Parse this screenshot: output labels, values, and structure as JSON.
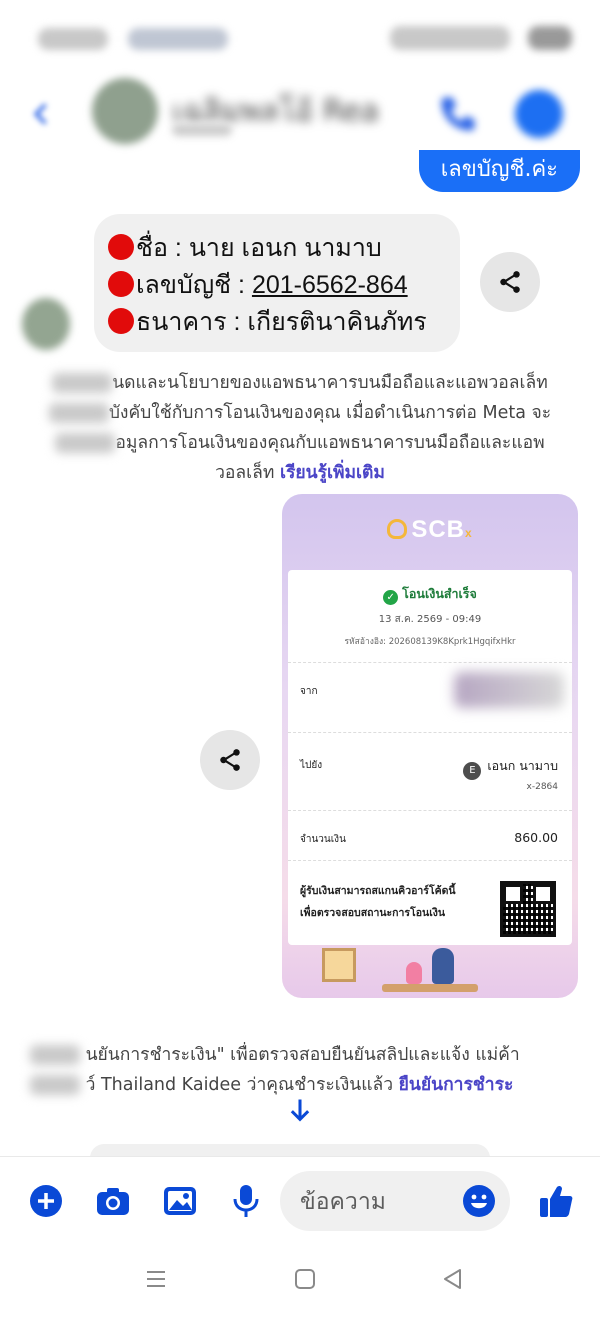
{
  "header": {
    "contact_name": "เฉลิมพลโอ้ Rea",
    "back_icon": "back-arrow-icon",
    "call_icon": "phone-icon",
    "info_icon": "info-icon"
  },
  "messages": {
    "outgoing_partial": "เลขบัญชี.ค่ะ",
    "account_lines": [
      {
        "label": "ชื่อ : นาย เอนก นามาบ",
        "plain": true
      },
      {
        "prefix": "เลขบัญชี : ",
        "value": "201-6562-864"
      },
      {
        "label": "ธนาคาร  : เกียรตินาคินภัทร",
        "plain": true
      }
    ],
    "notice_line1": "นดและนโยบายของแอพธนาคารบนมือถือและแอพวอลเล็ท",
    "notice_line2": "บังคับใช้กับการโอนเงินของคุณ เมื่อดำเนินการต่อ Meta จะ",
    "notice_line3": "อมูลการโอนเงินของคุณกับแอพธนาคารบนมือถือและแอพ",
    "notice_line4": "วอลเล็ท",
    "notice_link": "เรียนรู้เพิ่มเติม",
    "confirm_line1": "นยันการชำระเงิน\" เพื่อตรวจสอบยืนยันสลิปและแจ้ง แม่ค้า",
    "confirm_line2a": "ว์  Thailand Kaidee ว่าคุณชำระเงินแล้ว",
    "confirm_link": "ยืนยันการชำระ"
  },
  "slip": {
    "brand": "SCB",
    "brand_suffix": "x",
    "status": "โอนเงินสำเร็จ",
    "datetime": "13 ส.ค. 2569 - 09:49",
    "reference": "รหัสอ้างอิง: 202608139K8Kprk1HgqifxHkr",
    "from_label": "จาก",
    "to_label": "ไปยัง",
    "to_bank_badge": "E",
    "to_name": "เอนก นามาบ",
    "to_account": "x-2864",
    "amount_label": "จำนวนเงิน",
    "amount": "860.00",
    "qr_line1": "ผู้รับเงินสามารถสแกนคิวอาร์โค้ดนี้",
    "qr_line2": "เพื่อตรวจสอบสถานะการโอนเงิน"
  },
  "composer": {
    "placeholder": "ข้อความ",
    "icons": [
      "plus-icon",
      "camera-icon",
      "image-icon",
      "microphone-icon",
      "emoji-icon",
      "thumbs-up-icon"
    ]
  },
  "colors": {
    "accent": "#0a49d6",
    "bubble_out": "#1a6ff7",
    "link": "#4b45c7"
  }
}
